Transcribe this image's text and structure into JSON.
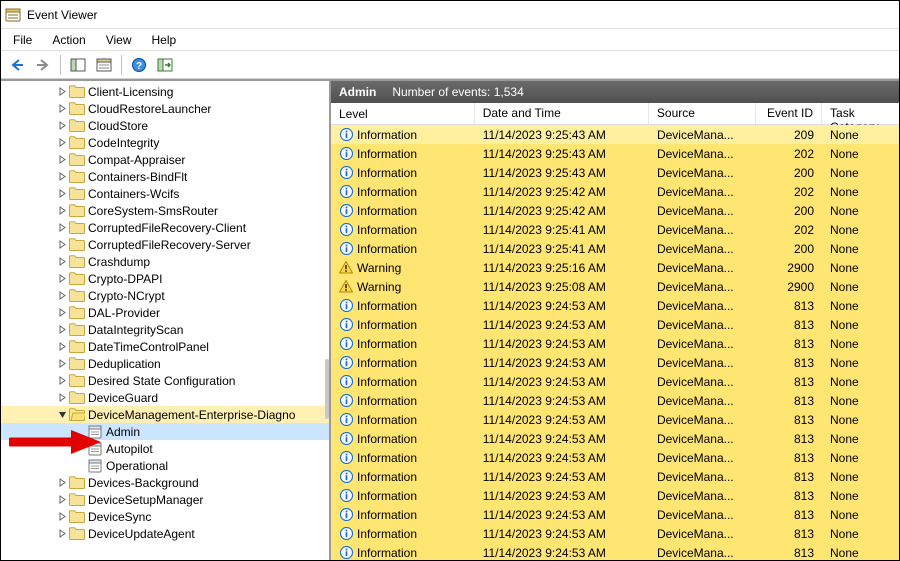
{
  "title": "Event Viewer",
  "menu": {
    "file": "File",
    "action": "Action",
    "view": "View",
    "help": "Help"
  },
  "tree": {
    "items": [
      {
        "label": "Client-Licensing",
        "expander": ">",
        "type": "folder"
      },
      {
        "label": "CloudRestoreLauncher",
        "expander": ">",
        "type": "folder"
      },
      {
        "label": "CloudStore",
        "expander": ">",
        "type": "folder"
      },
      {
        "label": "CodeIntegrity",
        "expander": ">",
        "type": "folder"
      },
      {
        "label": "Compat-Appraiser",
        "expander": ">",
        "type": "folder"
      },
      {
        "label": "Containers-BindFlt",
        "expander": ">",
        "type": "folder"
      },
      {
        "label": "Containers-Wcifs",
        "expander": ">",
        "type": "folder"
      },
      {
        "label": "CoreSystem-SmsRouter",
        "expander": ">",
        "type": "folder"
      },
      {
        "label": "CorruptedFileRecovery-Client",
        "expander": ">",
        "type": "folder"
      },
      {
        "label": "CorruptedFileRecovery-Server",
        "expander": ">",
        "type": "folder"
      },
      {
        "label": "Crashdump",
        "expander": ">",
        "type": "folder"
      },
      {
        "label": "Crypto-DPAPI",
        "expander": ">",
        "type": "folder"
      },
      {
        "label": "Crypto-NCrypt",
        "expander": ">",
        "type": "folder"
      },
      {
        "label": "DAL-Provider",
        "expander": ">",
        "type": "folder"
      },
      {
        "label": "DataIntegrityScan",
        "expander": ">",
        "type": "folder"
      },
      {
        "label": "DateTimeControlPanel",
        "expander": ">",
        "type": "folder"
      },
      {
        "label": "Deduplication",
        "expander": ">",
        "type": "folder"
      },
      {
        "label": "Desired State Configuration",
        "expander": ">",
        "type": "folder"
      },
      {
        "label": "DeviceGuard",
        "expander": ">",
        "type": "folder"
      },
      {
        "label": "DeviceManagement-Enterprise-Diagno",
        "expander": "v",
        "type": "folder",
        "selected": true
      },
      {
        "label": "Admin",
        "expander": "",
        "type": "log",
        "depth": 3,
        "active": true
      },
      {
        "label": "Autopilot",
        "expander": "",
        "type": "log",
        "depth": 3
      },
      {
        "label": "Operational",
        "expander": "",
        "type": "log",
        "depth": 3
      },
      {
        "label": "Devices-Background",
        "expander": ">",
        "type": "folder"
      },
      {
        "label": "DeviceSetupManager",
        "expander": ">",
        "type": "folder"
      },
      {
        "label": "DeviceSync",
        "expander": ">",
        "type": "folder"
      },
      {
        "label": "DeviceUpdateAgent",
        "expander": ">",
        "type": "folder"
      }
    ]
  },
  "detail": {
    "title": "Admin",
    "count_label": "Number of events: 1,534",
    "columns": {
      "level": "Level",
      "date": "Date and Time",
      "source": "Source",
      "eventid": "Event ID",
      "task": "Task Category"
    },
    "rows": [
      {
        "level": "Information",
        "icon": "info",
        "date": "11/14/2023 9:25:43 AM",
        "source": "DeviceMana...",
        "eventid": "209",
        "task": "None",
        "sel": true
      },
      {
        "level": "Information",
        "icon": "info",
        "date": "11/14/2023 9:25:43 AM",
        "source": "DeviceMana...",
        "eventid": "202",
        "task": "None"
      },
      {
        "level": "Information",
        "icon": "info",
        "date": "11/14/2023 9:25:43 AM",
        "source": "DeviceMana...",
        "eventid": "200",
        "task": "None"
      },
      {
        "level": "Information",
        "icon": "info",
        "date": "11/14/2023 9:25:42 AM",
        "source": "DeviceMana...",
        "eventid": "202",
        "task": "None"
      },
      {
        "level": "Information",
        "icon": "info",
        "date": "11/14/2023 9:25:42 AM",
        "source": "DeviceMana...",
        "eventid": "200",
        "task": "None"
      },
      {
        "level": "Information",
        "icon": "info",
        "date": "11/14/2023 9:25:41 AM",
        "source": "DeviceMana...",
        "eventid": "202",
        "task": "None"
      },
      {
        "level": "Information",
        "icon": "info",
        "date": "11/14/2023 9:25:41 AM",
        "source": "DeviceMana...",
        "eventid": "200",
        "task": "None"
      },
      {
        "level": "Warning",
        "icon": "warn",
        "date": "11/14/2023 9:25:16 AM",
        "source": "DeviceMana...",
        "eventid": "2900",
        "task": "None"
      },
      {
        "level": "Warning",
        "icon": "warn",
        "date": "11/14/2023 9:25:08 AM",
        "source": "DeviceMana...",
        "eventid": "2900",
        "task": "None"
      },
      {
        "level": "Information",
        "icon": "info",
        "date": "11/14/2023 9:24:53 AM",
        "source": "DeviceMana...",
        "eventid": "813",
        "task": "None"
      },
      {
        "level": "Information",
        "icon": "info",
        "date": "11/14/2023 9:24:53 AM",
        "source": "DeviceMana...",
        "eventid": "813",
        "task": "None"
      },
      {
        "level": "Information",
        "icon": "info",
        "date": "11/14/2023 9:24:53 AM",
        "source": "DeviceMana...",
        "eventid": "813",
        "task": "None"
      },
      {
        "level": "Information",
        "icon": "info",
        "date": "11/14/2023 9:24:53 AM",
        "source": "DeviceMana...",
        "eventid": "813",
        "task": "None"
      },
      {
        "level": "Information",
        "icon": "info",
        "date": "11/14/2023 9:24:53 AM",
        "source": "DeviceMana...",
        "eventid": "813",
        "task": "None"
      },
      {
        "level": "Information",
        "icon": "info",
        "date": "11/14/2023 9:24:53 AM",
        "source": "DeviceMana...",
        "eventid": "813",
        "task": "None"
      },
      {
        "level": "Information",
        "icon": "info",
        "date": "11/14/2023 9:24:53 AM",
        "source": "DeviceMana...",
        "eventid": "813",
        "task": "None"
      },
      {
        "level": "Information",
        "icon": "info",
        "date": "11/14/2023 9:24:53 AM",
        "source": "DeviceMana...",
        "eventid": "813",
        "task": "None"
      },
      {
        "level": "Information",
        "icon": "info",
        "date": "11/14/2023 9:24:53 AM",
        "source": "DeviceMana...",
        "eventid": "813",
        "task": "None"
      },
      {
        "level": "Information",
        "icon": "info",
        "date": "11/14/2023 9:24:53 AM",
        "source": "DeviceMana...",
        "eventid": "813",
        "task": "None"
      },
      {
        "level": "Information",
        "icon": "info",
        "date": "11/14/2023 9:24:53 AM",
        "source": "DeviceMana...",
        "eventid": "813",
        "task": "None"
      },
      {
        "level": "Information",
        "icon": "info",
        "date": "11/14/2023 9:24:53 AM",
        "source": "DeviceMana...",
        "eventid": "813",
        "task": "None"
      },
      {
        "level": "Information",
        "icon": "info",
        "date": "11/14/2023 9:24:53 AM",
        "source": "DeviceMana...",
        "eventid": "813",
        "task": "None"
      },
      {
        "level": "Information",
        "icon": "info",
        "date": "11/14/2023 9:24:53 AM",
        "source": "DeviceMana...",
        "eventid": "813",
        "task": "None"
      }
    ]
  }
}
